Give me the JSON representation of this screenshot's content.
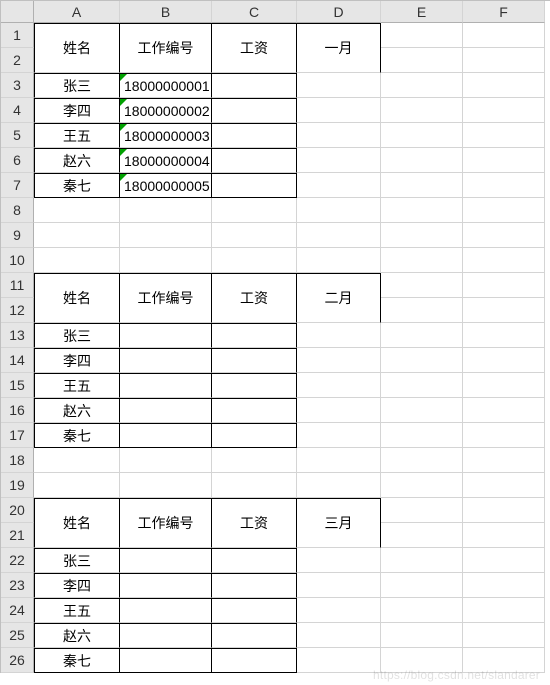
{
  "columns": [
    "A",
    "B",
    "C",
    "D",
    "E",
    "F"
  ],
  "rows": [
    "1",
    "2",
    "3",
    "4",
    "5",
    "6",
    "7",
    "8",
    "9",
    "10",
    "11",
    "12",
    "13",
    "14",
    "15",
    "16",
    "17",
    "18",
    "19",
    "20",
    "21",
    "22",
    "23",
    "24",
    "25",
    "26"
  ],
  "blocks": [
    {
      "header": {
        "name": "姓名",
        "id": "工作编号",
        "salary": "工资",
        "month": "一月"
      },
      "data": [
        {
          "name": "张三",
          "id": "18000000001"
        },
        {
          "name": "李四",
          "id": "18000000002"
        },
        {
          "name": "王五",
          "id": "18000000003"
        },
        {
          "name": "赵六",
          "id": "18000000004"
        },
        {
          "name": "秦七",
          "id": "18000000005"
        }
      ]
    },
    {
      "header": {
        "name": "姓名",
        "id": "工作编号",
        "salary": "工资",
        "month": "二月"
      },
      "data": [
        {
          "name": "张三",
          "id": ""
        },
        {
          "name": "李四",
          "id": ""
        },
        {
          "name": "王五",
          "id": ""
        },
        {
          "name": "赵六",
          "id": ""
        },
        {
          "name": "秦七",
          "id": ""
        }
      ]
    },
    {
      "header": {
        "name": "姓名",
        "id": "工作编号",
        "salary": "工资",
        "month": "三月"
      },
      "data": [
        {
          "name": "张三",
          "id": ""
        },
        {
          "name": "李四",
          "id": ""
        },
        {
          "name": "王五",
          "id": ""
        },
        {
          "name": "赵六",
          "id": ""
        },
        {
          "name": "秦七",
          "id": ""
        }
      ]
    }
  ],
  "watermark": "https://blog.csdn.net/slandarer"
}
